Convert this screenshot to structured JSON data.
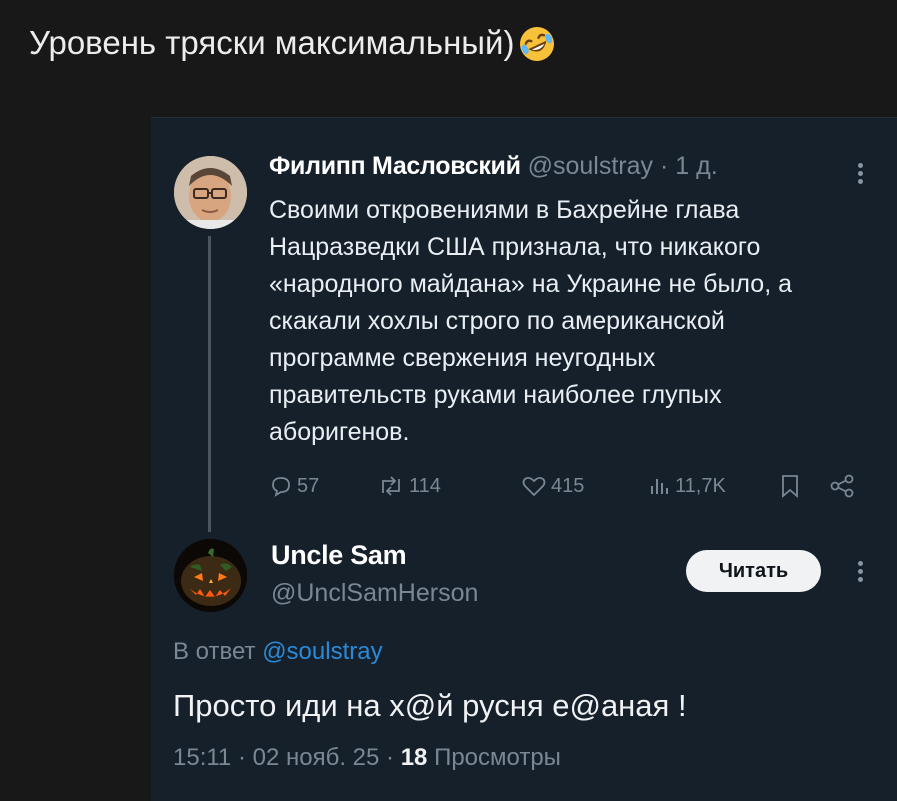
{
  "caption": {
    "text": "Уровень тряски максимальный)",
    "emoji": "rolling-on-floor-laughing-emoji"
  },
  "original_tweet": {
    "author_name": "Филипп Масловский",
    "handle": "@soulstray",
    "time_ago": "· 1 д.",
    "text_lines": [
      "Своими откровениями в Бахрейне глава",
      "Нацразведки США признала, что никакого",
      "«народного майдана» на Украине не было, а",
      "скакали хохлы строго по американской",
      "программе свержения неугодных",
      "правительств руками наиболее глупых",
      "аборигенов."
    ],
    "actions": {
      "replies": "57",
      "retweets": "114",
      "likes": "415",
      "views": "11,7K"
    }
  },
  "reply_tweet": {
    "author_name": "Uncle Sam",
    "handle": "@UnclSamHerson",
    "follow_label": "Читать",
    "reply_prefix": "В ответ",
    "reply_to": "@soulstray",
    "text": "Просто иди на х@й русня е@аная !",
    "time": "15:11 · 02 нояб. 25 ·",
    "views_count": "18",
    "views_label": "Просмотры"
  },
  "colors": {
    "background": "#181818",
    "tweet_bg": "#15202b",
    "link": "#2b8ad8",
    "muted": "#7a8794"
  }
}
